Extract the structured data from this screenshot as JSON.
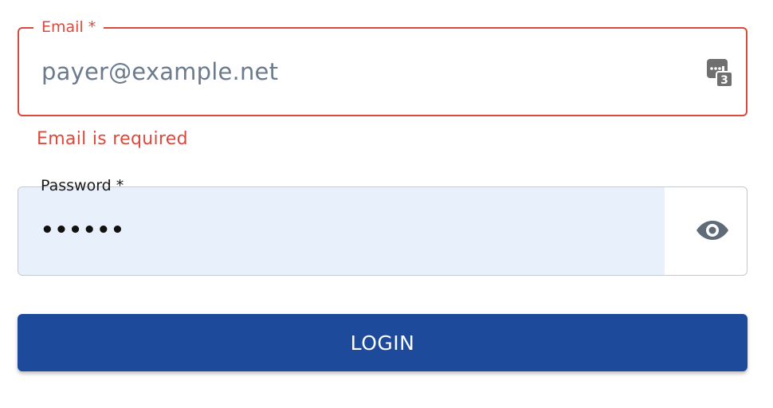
{
  "email_field": {
    "label": "Email *",
    "value": "payer@example.net",
    "error": "Email is required",
    "autofill_icon": "password-manager-icon",
    "autofill_badge": "3",
    "border_color": "#d94a3d"
  },
  "password_field": {
    "label": "Password *",
    "value": "••••••",
    "toggle_icon": "eye-icon",
    "autofill_background": "#e8f0fc"
  },
  "login_button": {
    "label": "LOGIN",
    "color": "#1d4a9a"
  }
}
